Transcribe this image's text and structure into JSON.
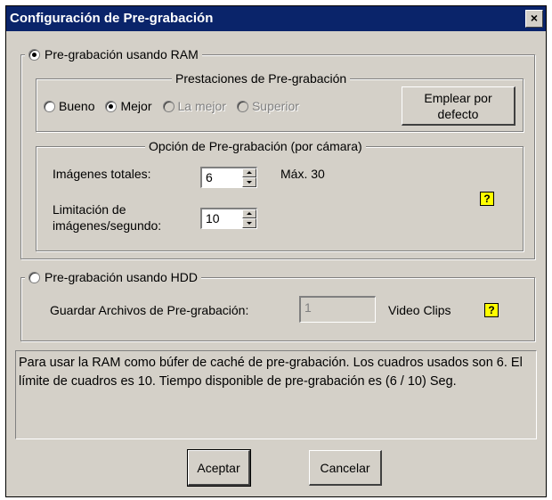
{
  "window": {
    "title": "Configuración de Pre-grabación",
    "close_label": "×"
  },
  "ram": {
    "radio_label": "Pre-grabación usando RAM",
    "selected": true,
    "performance": {
      "legend": "Prestaciones de Pre-grabación",
      "options": [
        "Bueno",
        "Mejor",
        "La mejor",
        "Superior"
      ],
      "selected": "Mejor",
      "disabled": [
        "La mejor",
        "Superior"
      ],
      "default_button": "Emplear por defecto"
    },
    "option": {
      "legend": "Opción de Pre-grabación (por cámara)",
      "total_images_label": "Imágenes totales:",
      "total_images_value": "6",
      "max_label": "Máx. 30",
      "fps_label_line1": "Limitación de",
      "fps_label_line2": "imágenes/segundo:",
      "fps_value": "10",
      "help_icon": "question-mark-icon",
      "help_glyph": "?"
    }
  },
  "hdd": {
    "radio_label": "Pre-grabación usando HDD",
    "selected": false,
    "save_label": "Guardar Archivos de Pre-grabación:",
    "save_value": "1",
    "unit_label": "Video Clips",
    "help_glyph": "?"
  },
  "info_text": "Para usar la RAM como búfer de caché de pre-grabación. Los cuadros usados son 6. El límite de cuadros es 10. Tiempo disponible de pre-grabación es (6 / 10) Seg.",
  "buttons": {
    "accept": "Aceptar",
    "cancel": "Cancelar"
  },
  "colors": {
    "titlebar": "#0a246a",
    "face": "#d4d0c8",
    "help": "#ffff00"
  }
}
